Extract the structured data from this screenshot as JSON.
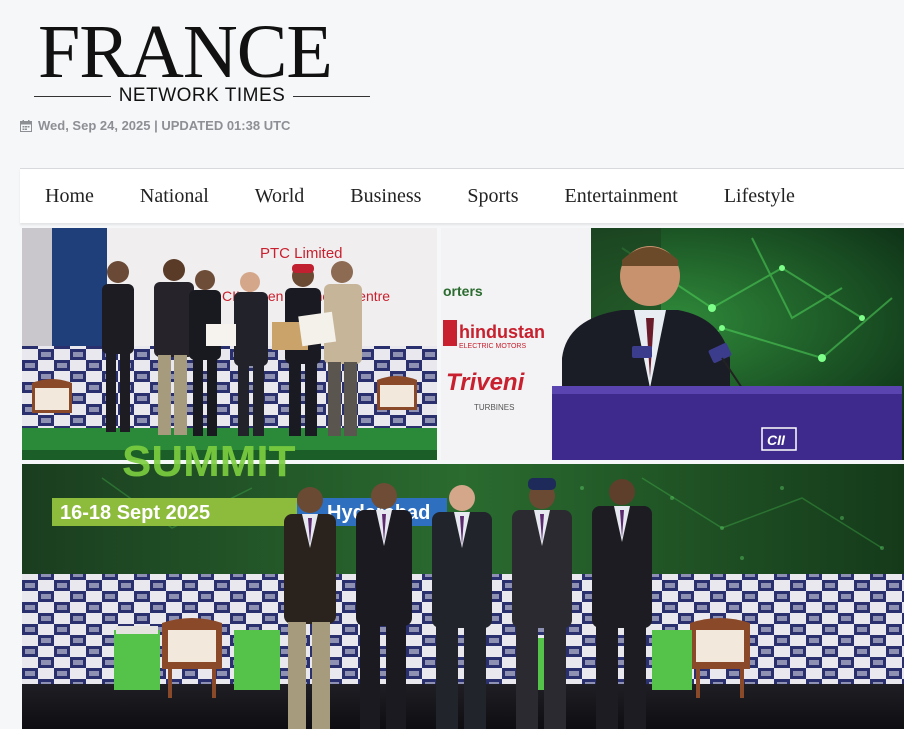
{
  "site": {
    "logo_main": "FRANCE",
    "logo_sub": "NETWORK TIMES",
    "dateline": "Wed, Sep 24, 2025 | UPDATED 01:38 UTC"
  },
  "nav": {
    "items": [
      "Home",
      "National",
      "World",
      "Business",
      "Sports",
      "Entertainment",
      "Lifestyle"
    ]
  },
  "photo": {
    "banner_company": "PTC Limited",
    "banner_award": "CII-Green Business Centre",
    "sponsor_1": "orters",
    "sponsor_2": "hindustan",
    "sponsor_2_sub": "ELECTRIC MOTORS",
    "sponsor_3": "Triveni",
    "sponsor_3_sub": "TURBINES",
    "podium_logo": "CII",
    "summit_word": "SUMMIT",
    "summit_dates": "16-18 Sept 2025",
    "summit_city": "Hyderabad"
  },
  "colors": {
    "accent_green": "#2db34a",
    "podium_purple": "#3e2a8c",
    "banner_red": "#c8202e"
  }
}
